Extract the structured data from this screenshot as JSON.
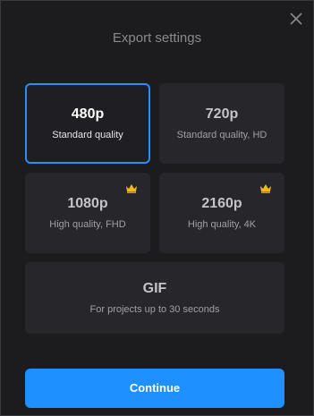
{
  "dialog": {
    "title": "Export settings",
    "close_icon": "close-icon"
  },
  "options": [
    {
      "resolution": "480p",
      "description": "Standard quality",
      "selected": true,
      "premium": false
    },
    {
      "resolution": "720p",
      "description": "Standard quality, HD",
      "selected": false,
      "premium": false
    },
    {
      "resolution": "1080p",
      "description": "High quality, FHD",
      "selected": false,
      "premium": true
    },
    {
      "resolution": "2160p",
      "description": "High quality, 4K",
      "selected": false,
      "premium": true
    },
    {
      "resolution": "GIF",
      "description": "For projects up to 30 seconds",
      "selected": false,
      "premium": false
    }
  ],
  "footer": {
    "continue_label": "Continue"
  },
  "colors": {
    "accent": "#1e90ff",
    "selected_border": "#2d8cff",
    "crown": "#f5b81d",
    "background": "#1c1c1f",
    "card": "#27272b"
  }
}
